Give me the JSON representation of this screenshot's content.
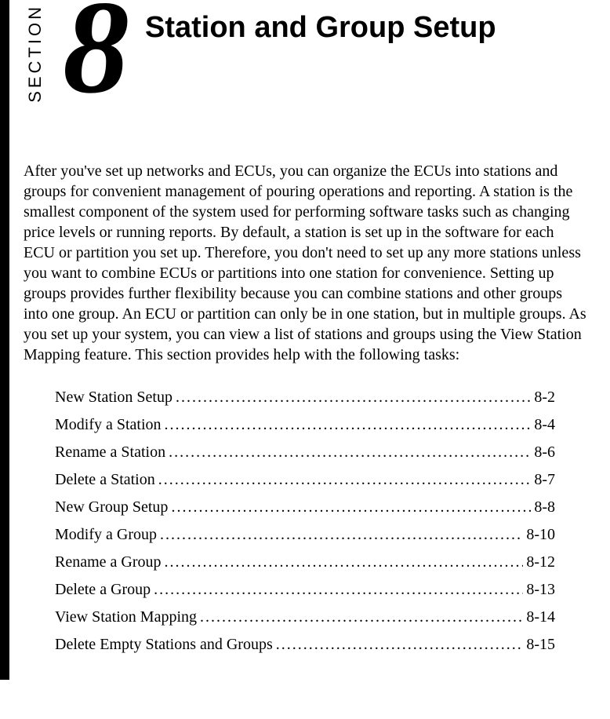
{
  "section": {
    "label": "SECTION",
    "number": "8",
    "title": "Station and Group Setup"
  },
  "intro": "After you've set up networks and ECUs, you can organize the ECUs into stations and groups for convenient management of pouring operations and reporting. A station is the smallest component of the system used for performing software tasks such as changing price levels or running reports. By default, a station is set up in the software for each ECU or partition you set up. Therefore, you don't need to set up any more stations unless you want to combine ECUs or partitions into one station for convenience. Setting up groups provides further flexibility because you can combine stations and other groups into one group. An ECU or partition can only be in one station, but in multiple groups. As you set up your system, you can view a list of stations and groups using the View Station Mapping feature. This section provides help with the following tasks:",
  "toc": [
    {
      "title": "New Station Setup",
      "page": "8-2"
    },
    {
      "title": "Modify a Station",
      "page": "8-4"
    },
    {
      "title": "Rename a Station",
      "page": "8-6"
    },
    {
      "title": "Delete a Station",
      "page": "8-7"
    },
    {
      "title": "New Group Setup",
      "page": "8-8"
    },
    {
      "title": "Modify a Group",
      "page": "8-10"
    },
    {
      "title": "Rename a Group",
      "page": "8-12"
    },
    {
      "title": "Delete a Group",
      "page": "8-13"
    },
    {
      "title": "View Station Mapping",
      "page": "8-14"
    },
    {
      "title": "Delete Empty Stations and Groups",
      "page": "8-15"
    }
  ]
}
